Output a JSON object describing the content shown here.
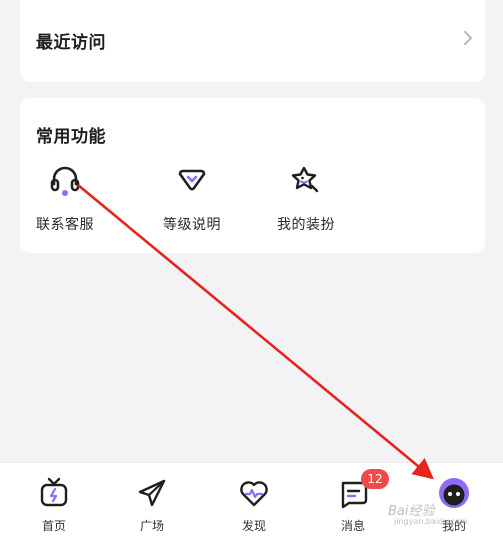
{
  "recent": {
    "title": "最近访问",
    "chevron_icon": "chevron-right-icon"
  },
  "functions": {
    "title": "常用功能",
    "items": [
      {
        "label": "联系客服",
        "icon": "headset-icon"
      },
      {
        "label": "等级说明",
        "icon": "level-badge-icon"
      },
      {
        "label": "我的装扮",
        "icon": "star-dressup-icon"
      }
    ]
  },
  "tabbar": {
    "items": [
      {
        "label": "首页",
        "icon": "tv-icon"
      },
      {
        "label": "广场",
        "icon": "paper-plane-icon"
      },
      {
        "label": "发现",
        "icon": "heart-pulse-icon"
      },
      {
        "label": "消息",
        "icon": "message-icon",
        "badge": "12"
      },
      {
        "label": "我的",
        "icon": "avatar-face-icon"
      }
    ]
  },
  "watermark": {
    "main": "Bai经验",
    "sub": "jingyan.baidu.com"
  },
  "colors": {
    "accent_purple": "#8f6cf6",
    "annotation_red": "#e8231d",
    "badge_red": "#f24a4a"
  }
}
